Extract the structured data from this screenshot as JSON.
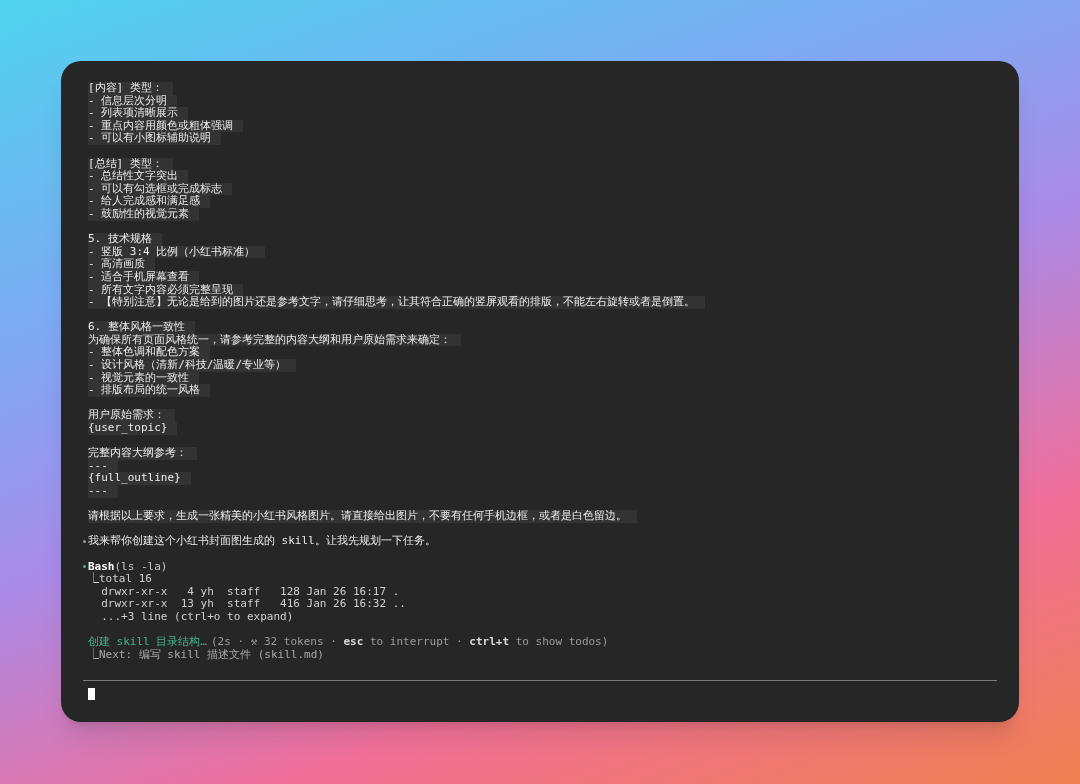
{
  "transcript": [
    {
      "kind": "prompt",
      "text": "[内容] 类型："
    },
    {
      "kind": "prompt",
      "text": "- 信息层次分明"
    },
    {
      "kind": "prompt",
      "text": "- 列表项清晰展示"
    },
    {
      "kind": "prompt",
      "text": "- 重点内容用颜色或粗体强调"
    },
    {
      "kind": "prompt",
      "text": "- 可以有小图标辅助说明"
    },
    {
      "kind": "blank"
    },
    {
      "kind": "prompt",
      "text": "[总结] 类型："
    },
    {
      "kind": "prompt",
      "text": "- 总结性文字突出"
    },
    {
      "kind": "prompt",
      "text": "- 可以有勾选框或完成标志"
    },
    {
      "kind": "prompt",
      "text": "- 给人完成感和满足感"
    },
    {
      "kind": "prompt",
      "text": "- 鼓励性的视觉元素"
    },
    {
      "kind": "blank"
    },
    {
      "kind": "prompt",
      "text": "5. 技术规格"
    },
    {
      "kind": "prompt",
      "text": "- 竖版 3:4 比例（小红书标准）"
    },
    {
      "kind": "prompt",
      "text": "- 高清画质"
    },
    {
      "kind": "prompt",
      "text": "- 适合手机屏幕查看"
    },
    {
      "kind": "prompt",
      "text": "- 所有文字内容必须完整呈现"
    },
    {
      "kind": "prompt",
      "text": "- 【特别注意】无论是给到的图片还是参考文字，请仔细思考，让其符合正确的竖屏观看的排版，不能左右旋转或者是倒置。"
    },
    {
      "kind": "blank"
    },
    {
      "kind": "prompt",
      "text": "6. 整体风格一致性"
    },
    {
      "kind": "prompt",
      "text": "为确保所有页面风格统一，请参考完整的内容大纲和用户原始需求来确定："
    },
    {
      "kind": "prompt",
      "text": "- 整体色调和配色方案"
    },
    {
      "kind": "prompt",
      "text": "- 设计风格（清新/科技/温暖/专业等）"
    },
    {
      "kind": "prompt",
      "text": "- 视觉元素的一致性"
    },
    {
      "kind": "prompt",
      "text": "- 排版布局的统一风格"
    },
    {
      "kind": "blank"
    },
    {
      "kind": "prompt",
      "text": "用户原始需求："
    },
    {
      "kind": "prompt",
      "text": "{user_topic}"
    },
    {
      "kind": "blank"
    },
    {
      "kind": "prompt",
      "text": "完整内容大纲参考："
    },
    {
      "kind": "prompt",
      "text": "---"
    },
    {
      "kind": "prompt",
      "text": "{full_outline}"
    },
    {
      "kind": "prompt",
      "text": "---"
    },
    {
      "kind": "blank"
    },
    {
      "kind": "prompt",
      "text": "请根据以上要求，生成一张精美的小红书风格图片。请直接给出图片，不要有任何手机边框，或者是白色留边。"
    },
    {
      "kind": "blank"
    },
    {
      "kind": "response",
      "text": "我来帮你创建这个小红书封面图生成的 skill。让我先规划一下任务。"
    },
    {
      "kind": "blank"
    },
    {
      "kind": "tool",
      "text": "**Bash**(ls -la)"
    },
    {
      "kind": "output",
      "text": "⎿total 16"
    },
    {
      "kind": "output",
      "text": "  drwxr-xr-x   4 yh  staff   128 Jan 26 16:17 ."
    },
    {
      "kind": "output",
      "text": "  drwxr-xr-x  13 yh  staff   416 Jan 26 16:32 .."
    },
    {
      "kind": "output",
      "text": "  ...+3 line (ctrl+o to expand)"
    },
    {
      "kind": "blank"
    },
    {
      "kind": "status",
      "activity": "创建 skill 目录结构…",
      "text": "(2s · ⚒ 32 tokens · **esc** to interrupt · **ctrl+t** to show todos)"
    },
    {
      "kind": "next",
      "text": "⎿Next: 编写 skill 描述文件 (skill.md)"
    }
  ]
}
